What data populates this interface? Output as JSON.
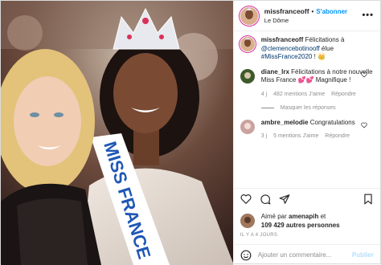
{
  "post": {
    "username": "missfranceoff",
    "location": "Le Dôme",
    "follow_label": "S'abonner",
    "more_label": "•••",
    "caption": {
      "username": "missfranceoff",
      "text_prefix": "Félicitations à ",
      "mention": "@clemencebotinooff",
      "text_mid": " élue ",
      "hashtag": "#MissFrance2020",
      "text_suffix": " ! 👑"
    },
    "comments": [
      {
        "username": "diane_lrx",
        "text": "Félicitations à notre nouvelle Miss France 💕💕 Magnifique !",
        "age": "4 j",
        "likes": "482 mentions J'aime",
        "reply": "Répondre",
        "replies_label": "Masquer les réponses"
      },
      {
        "username": "ambre_melodie",
        "text": "Congratulations",
        "age": "3 j",
        "likes": "5 mentions J'aime",
        "reply": "Répondre"
      }
    ],
    "liked_by_prefix": "Aimé par ",
    "liked_by_user": "amenapih",
    "liked_by_and": " et",
    "liked_by_count": "109 429 autres personnes",
    "date": "IL Y A 4 JOURS",
    "comment_placeholder": "Ajouter un commentaire...",
    "publish_label": "Publier",
    "photo_sash_text": "MISS FRANCE"
  },
  "colors": {
    "link": "#0095f6",
    "tag": "#00376b",
    "muted": "#8e8e8e",
    "heart": "#ed4956"
  }
}
